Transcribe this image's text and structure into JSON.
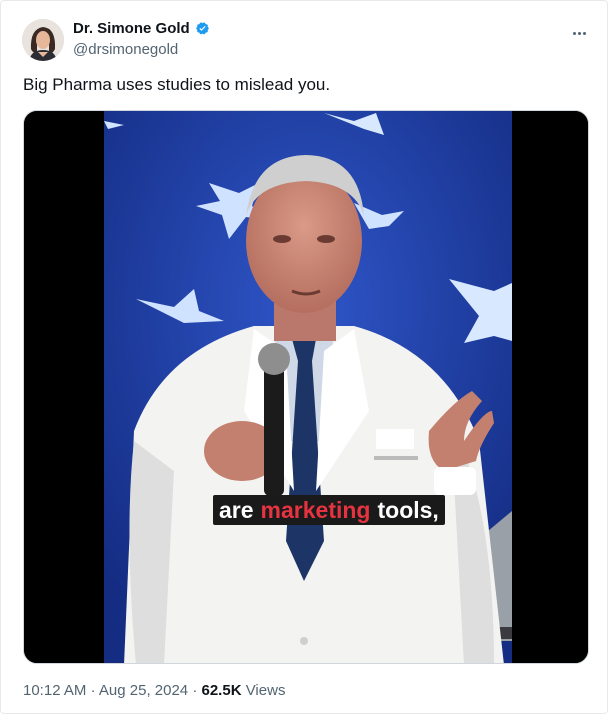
{
  "tweet": {
    "author_name": "Dr. Simone Gold",
    "author_handle": "@drsimonegold",
    "text": "Big Pharma uses studies to mislead you.",
    "video_caption": {
      "word1": "are",
      "word2": "marketing",
      "word3": "tools,"
    },
    "time": "10:12 AM",
    "date": "Aug 25, 2024",
    "views_count": "62.5K",
    "views_label": "Views",
    "separator": "·"
  },
  "icons": {
    "verified": "verified-badge-icon",
    "more": "more-options-icon"
  },
  "colors": {
    "verified_blue": "#1d9bf0",
    "caption_highlight": "#e53340",
    "stage_blue": "#1c3fa8"
  }
}
